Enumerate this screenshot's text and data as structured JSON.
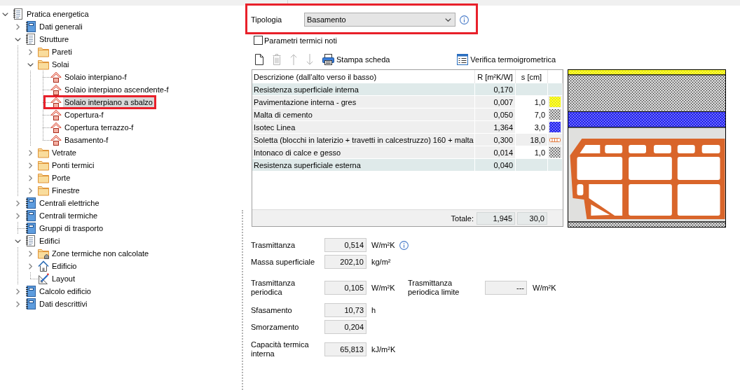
{
  "tree": [
    {
      "label": "Pratica energetica",
      "kind": "document",
      "expanded": true,
      "selected": false,
      "framed": false,
      "children": [
        {
          "label": "Dati generali",
          "kind": "form",
          "expanded": false,
          "selected": false,
          "framed": false
        },
        {
          "label": "Strutture",
          "kind": "document",
          "expanded": true,
          "selected": false,
          "framed": false,
          "children": [
            {
              "label": "Pareti",
              "kind": "folder",
              "expanded": false,
              "selected": false,
              "framed": false
            },
            {
              "label": "Solai",
              "kind": "folder",
              "expanded": true,
              "selected": false,
              "framed": false,
              "children": [
                {
                  "label": "Solaio interpiano-f",
                  "kind": "roof",
                  "selected": false,
                  "framed": false
                },
                {
                  "label": "Solaio interpiano ascendente-f",
                  "kind": "roof",
                  "selected": false,
                  "framed": false
                },
                {
                  "label": "Solaio interpiano a sbalzo",
                  "kind": "roof",
                  "selected": true,
                  "framed": true
                },
                {
                  "label": "Copertura-f",
                  "kind": "roof",
                  "selected": false,
                  "framed": false
                },
                {
                  "label": "Copertura terrazzo-f",
                  "kind": "roof",
                  "selected": false,
                  "framed": false
                },
                {
                  "label": "Basamento-f",
                  "kind": "roof",
                  "selected": false,
                  "framed": false
                }
              ]
            },
            {
              "label": "Vetrate",
              "kind": "folder",
              "expanded": false,
              "selected": false,
              "framed": false
            },
            {
              "label": "Ponti termici",
              "kind": "folder",
              "expanded": false,
              "selected": false,
              "framed": false
            },
            {
              "label": "Porte",
              "kind": "folder",
              "expanded": false,
              "selected": false,
              "framed": false
            },
            {
              "label": "Finestre",
              "kind": "folder",
              "expanded": false,
              "selected": false,
              "framed": false
            }
          ]
        },
        {
          "label": "Centrali elettriche",
          "kind": "form",
          "expanded": false,
          "selected": false,
          "framed": false
        },
        {
          "label": "Centrali termiche",
          "kind": "form",
          "expanded": false,
          "selected": false,
          "framed": false
        },
        {
          "label": "Gruppi di trasporto",
          "kind": "form",
          "selected": false,
          "framed": false
        },
        {
          "label": "Edifici",
          "kind": "document",
          "expanded": true,
          "selected": false,
          "framed": false,
          "children": [
            {
              "label": "Zone termiche non calcolate",
              "kind": "zones",
              "expanded": false,
              "selected": false,
              "framed": false
            },
            {
              "label": "Edificio",
              "kind": "house",
              "expanded": false,
              "selected": false,
              "framed": false
            },
            {
              "label": "Layout",
              "kind": "layout",
              "selected": false,
              "framed": false
            }
          ]
        },
        {
          "label": "Calcolo edificio",
          "kind": "form",
          "expanded": false,
          "selected": false,
          "framed": false
        },
        {
          "label": "Dati descrittivi",
          "kind": "form",
          "expanded": false,
          "selected": false,
          "framed": false
        }
      ]
    }
  ],
  "typology": {
    "label": "Tipologia",
    "value": "Basamento",
    "framed": true
  },
  "known_params": {
    "label": "Parametri termici noti",
    "checked": false
  },
  "toolbar": [
    {
      "kind": "new",
      "disabled": false
    },
    {
      "kind": "delete",
      "disabled": true
    },
    {
      "kind": "up",
      "disabled": true
    },
    {
      "kind": "down",
      "disabled": true
    },
    {
      "kind": "print",
      "label": "Stampa scheda",
      "disabled": false
    },
    {
      "kind": "check",
      "label": "Verifica termoigrometrica",
      "disabled": false
    }
  ],
  "layer_table": {
    "columns": [
      "Descrizione (dall'alto verso il basso)",
      "R [m²K/W]",
      "s [cm]"
    ],
    "rows": [
      {
        "kind": "surface",
        "description": "Resistenza superficiale interna",
        "r": "0,170"
      },
      {
        "kind": "tile",
        "description": "Pavimentazione interna - gres",
        "r": "0,007",
        "s": "1,0",
        "editable": true
      },
      {
        "kind": "mortar",
        "description": "Malta di cemento",
        "r": "0,050",
        "s": "7,0",
        "editable": true
      },
      {
        "kind": "insulation",
        "description": "Isotec Linea",
        "r": "1,364",
        "s": "3,0",
        "editable": true
      },
      {
        "kind": "brick",
        "description": "Soletta (blocchi in laterizio + travetti in calcestruzzo) 160 + malta",
        "r": "0,300",
        "s": "18,0",
        "editable": false
      },
      {
        "kind": "plaster",
        "description": "Intonaco di calce e gesso",
        "r": "0,014",
        "s": "1,0",
        "editable": true
      },
      {
        "kind": "surface",
        "description": "Resistenza superficiale esterna",
        "r": "0,040"
      }
    ],
    "total": {
      "label": "Totale:",
      "r": "1,945",
      "s": "30,0"
    }
  },
  "results": [
    {
      "fields": [
        {
          "label": "Trasmittanza",
          "value": "0,514",
          "unit": "W/m²K",
          "info": true
        }
      ]
    },
    {
      "fields": [
        {
          "label": "Massa superficiale",
          "value": "202,10",
          "unit": "kg/m²",
          "info": false
        }
      ]
    },
    {
      "fields": [
        {
          "label": "Trasmittanza periodica",
          "value": "0,105",
          "unit": "W/m²K",
          "info": false
        },
        {
          "label": "Trasmittanza periodica limite",
          "value": "---",
          "unit": "W/m²K",
          "info": false
        }
      ]
    },
    {
      "fields": [
        {
          "label": "Sfasamento",
          "value": "10,73",
          "unit": "h",
          "info": false
        }
      ]
    },
    {
      "fields": [
        {
          "label": "Smorzamento",
          "value": "0,204",
          "info": false
        }
      ]
    },
    {
      "fields": [
        {
          "label": "Capacità termica interna",
          "value": "65,813",
          "unit": "kJ/m²K",
          "info": false
        }
      ]
    }
  ]
}
